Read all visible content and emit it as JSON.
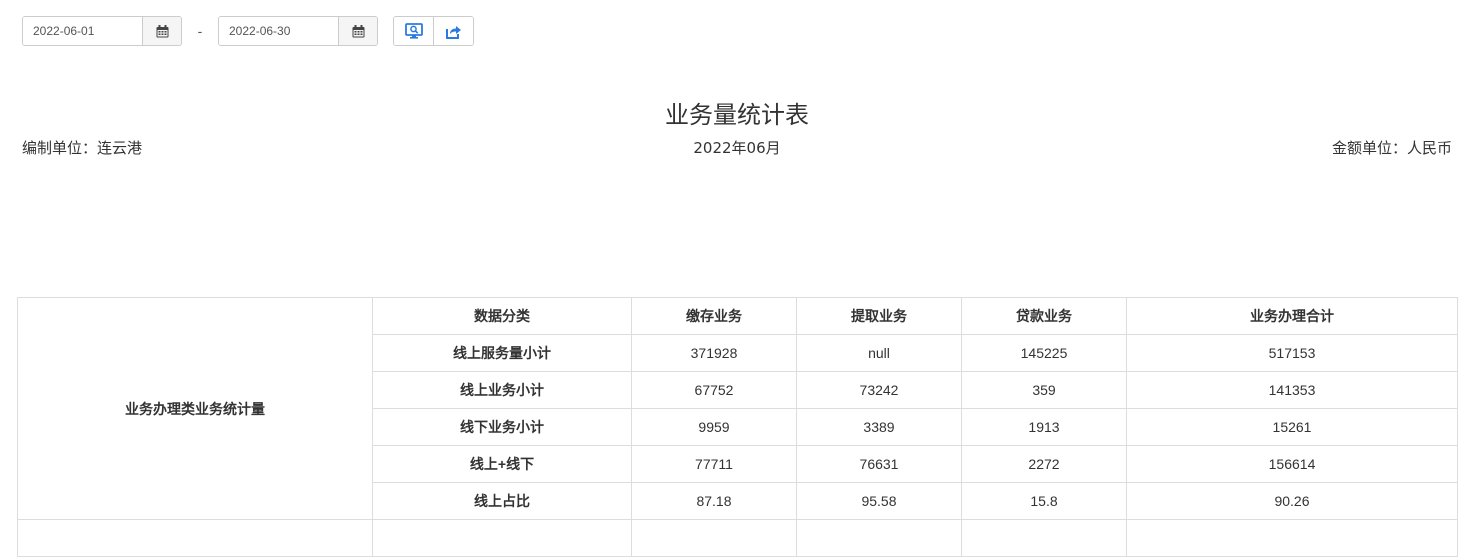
{
  "filters": {
    "start_date": "2022-06-01",
    "end_date": "2022-06-30",
    "separator": "-",
    "calendar_icon": "calendar-icon",
    "query_icon": "monitor-search-icon",
    "export_icon": "share-export-icon",
    "accent_color": "#2a7ae2"
  },
  "report": {
    "title": "业务量统计表",
    "unit_left": "编制单位：连云港",
    "period": "2022年06月",
    "unit_right": "金额单位：人民币"
  },
  "table": {
    "group_label": "业务办理类业务统计量",
    "headers": [
      "数据分类",
      "缴存业务",
      "提取业务",
      "贷款业务",
      "业务办理合计"
    ],
    "rows": [
      {
        "label": "线上服务量小计",
        "values": [
          "371928",
          "null",
          "145225",
          "517153"
        ]
      },
      {
        "label": "线上业务小计",
        "values": [
          "67752",
          "73242",
          "359",
          "141353"
        ]
      },
      {
        "label": "线下业务小计",
        "values": [
          "9959",
          "3389",
          "1913",
          "15261"
        ]
      },
      {
        "label": "线上+线下",
        "values": [
          "77711",
          "76631",
          "2272",
          "156614"
        ]
      },
      {
        "label": "线上占比",
        "values": [
          "87.18",
          "95.58",
          "15.8",
          "90.26"
        ]
      }
    ]
  }
}
